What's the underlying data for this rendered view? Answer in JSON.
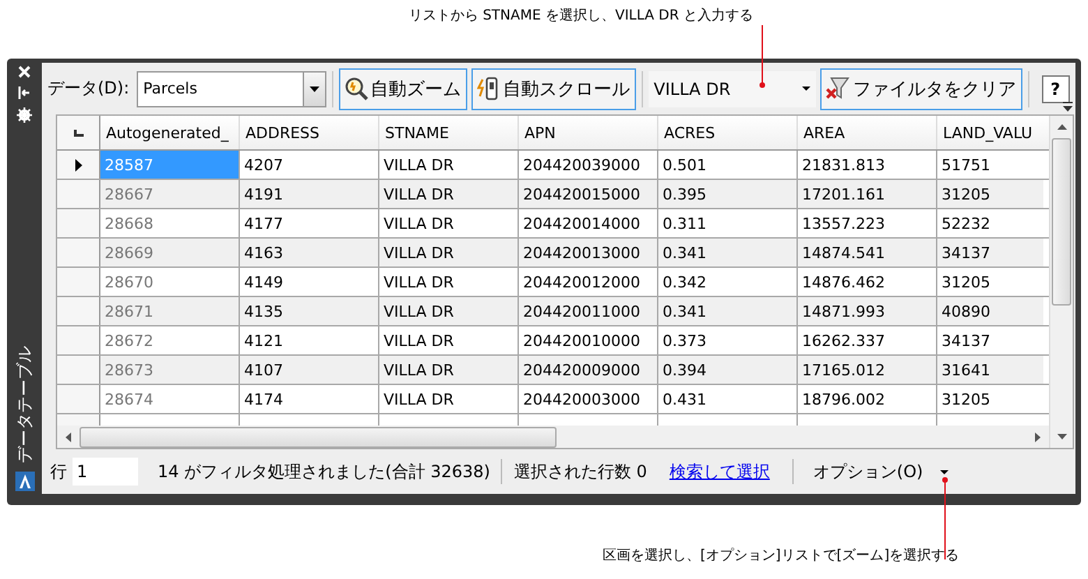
{
  "annotations": {
    "top": "リストから STNAME を選択し、VILLA DR と入力する",
    "bottom": "区画を選択し、[オプション]リストで[ズーム]を選択する"
  },
  "sidebar": {
    "title": "データテーブル"
  },
  "toolbar": {
    "data_label": "データ(D):",
    "data_source": "Parcels",
    "buttons": [
      {
        "kind": "zoom",
        "label": "自動ズーム"
      },
      {
        "kind": "scroll",
        "label": "自動スクロール"
      }
    ],
    "filter_value": "VILLA DR",
    "clear_button": "ファイルタをクリア",
    "help": "?"
  },
  "table": {
    "columns": [
      "Autogenerated_",
      "ADDRESS",
      "STNAME",
      "APN",
      "ACRES",
      "AREA",
      "LAND_VALU"
    ],
    "rows": [
      {
        "current": true,
        "cells": [
          "28587",
          "4207",
          "VILLA DR",
          "204420039000",
          "0.501",
          "21831.813",
          "51751"
        ]
      },
      {
        "current": false,
        "cells": [
          "28667",
          "4191",
          "VILLA DR",
          "204420015000",
          "0.395",
          "17201.161",
          "31205"
        ]
      },
      {
        "current": false,
        "cells": [
          "28668",
          "4177",
          "VILLA DR",
          "204420014000",
          "0.311",
          "13557.223",
          "52232"
        ]
      },
      {
        "current": false,
        "cells": [
          "28669",
          "4163",
          "VILLA DR",
          "204420013000",
          "0.341",
          "14874.541",
          "34137"
        ]
      },
      {
        "current": false,
        "cells": [
          "28670",
          "4149",
          "VILLA DR",
          "204420012000",
          "0.342",
          "14876.462",
          "31205"
        ]
      },
      {
        "current": false,
        "cells": [
          "28671",
          "4135",
          "VILLA DR",
          "204420011000",
          "0.341",
          "14871.993",
          "40890"
        ]
      },
      {
        "current": false,
        "cells": [
          "28672",
          "4121",
          "VILLA DR",
          "204420010000",
          "0.373",
          "16262.337",
          "34137"
        ]
      },
      {
        "current": false,
        "cells": [
          "28673",
          "4107",
          "VILLA DR",
          "204420009000",
          "0.394",
          "17165.012",
          "31641"
        ]
      },
      {
        "current": false,
        "cells": [
          "28674",
          "4174",
          "VILLA DR",
          "204420003000",
          "0.431",
          "18796.002",
          "31205"
        ]
      }
    ]
  },
  "status_bar": {
    "row_label": "行",
    "row_value": "1",
    "filter_info": "14 がフィルタ処理されました(合計 32638)",
    "selected_count": "選択された行数 0",
    "link": "検索して選択",
    "options": "オプション(O)"
  }
}
